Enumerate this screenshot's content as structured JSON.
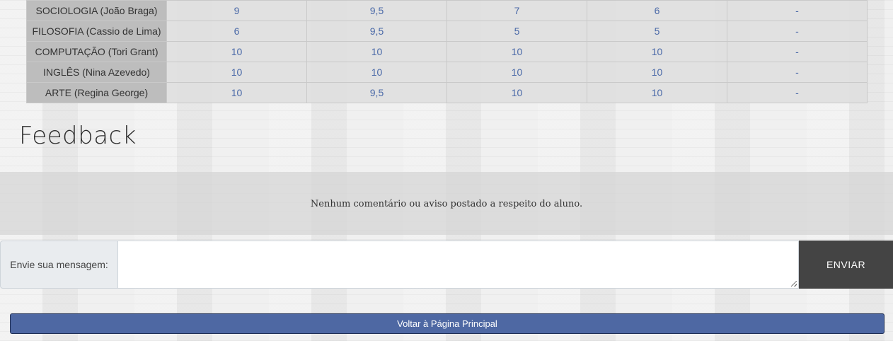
{
  "grades_table": {
    "rows": [
      {
        "subject": "SOCIOLOGIA (João Braga)",
        "g1": "9",
        "g2": "9,5",
        "g3": "7",
        "g4": "6",
        "g5": "-"
      },
      {
        "subject": "FILOSOFIA (Cassio de Lima)",
        "g1": "6",
        "g2": "9,5",
        "g3": "5",
        "g4": "5",
        "g5": "-"
      },
      {
        "subject": "COMPUTAÇÃO (Tori Grant)",
        "g1": "10",
        "g2": "10",
        "g3": "10",
        "g4": "10",
        "g5": "-"
      },
      {
        "subject": "INGLÊS (Nina Azevedo)",
        "g1": "10",
        "g2": "10",
        "g3": "10",
        "g4": "10",
        "g5": "-"
      },
      {
        "subject": "ARTE (Regina George)",
        "g1": "10",
        "g2": "9,5",
        "g3": "10",
        "g4": "10",
        "g5": "-"
      }
    ]
  },
  "feedback": {
    "title": "Feedback",
    "empty_message": "Nenhum comentário ou aviso postado a respeito do aluno."
  },
  "message_form": {
    "label": "Envie sua mensagem:",
    "input_value": "",
    "send_label": "ENVIAR"
  },
  "back_button": {
    "label": "Voltar à Página Principal"
  },
  "colors": {
    "subject_cell_bg": "#bdbdbd",
    "grade_text": "#4a69a8",
    "send_button_bg": "#444444",
    "back_button_bg": "#4e68a3"
  }
}
